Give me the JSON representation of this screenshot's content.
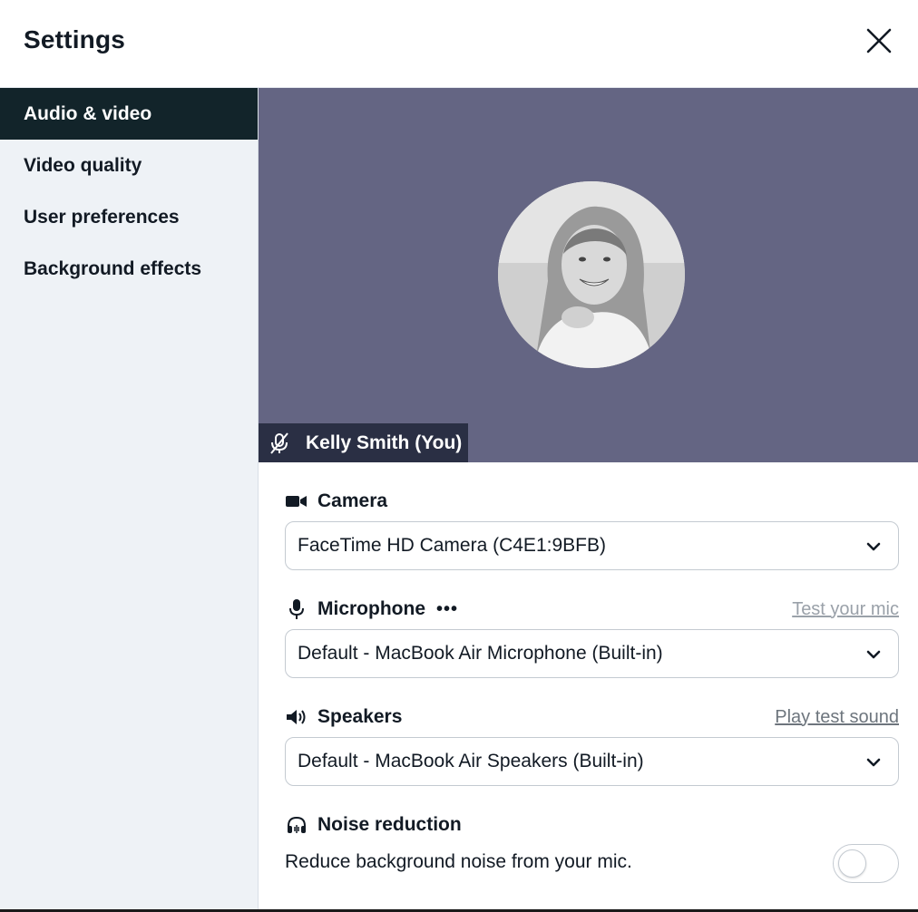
{
  "header": {
    "title": "Settings"
  },
  "sidebar": {
    "items": [
      {
        "label": "Audio & video",
        "active": true
      },
      {
        "label": "Video quality",
        "active": false
      },
      {
        "label": "User preferences",
        "active": false
      },
      {
        "label": "Background effects",
        "active": false
      }
    ]
  },
  "video": {
    "background_color": "#646583",
    "participant_name": "Kelly Smith (You)",
    "mic_state_icon": "mic-off-icon"
  },
  "camera": {
    "label": "Camera",
    "icon": "camera-icon",
    "selected": "FaceTime HD Camera (C4E1:9BFB)"
  },
  "microphone": {
    "label": "Microphone",
    "icon": "microphone-icon",
    "activity": "•••",
    "link": "Test your mic",
    "selected": "Default - MacBook Air Microphone (Built-in)"
  },
  "speakers": {
    "label": "Speakers",
    "icon": "speaker-icon",
    "link": "Play test sound",
    "selected": "Default - MacBook Air Speakers (Built-in)"
  },
  "noise_reduction": {
    "label": "Noise reduction",
    "icon": "headphones-icon",
    "description": "Reduce background noise from your mic.",
    "enabled": false
  },
  "colors": {
    "sidebar_active_bg": "#12242a",
    "sidebar_bg": "#eef2f6",
    "name_tag_bg": "#2a2f44"
  }
}
